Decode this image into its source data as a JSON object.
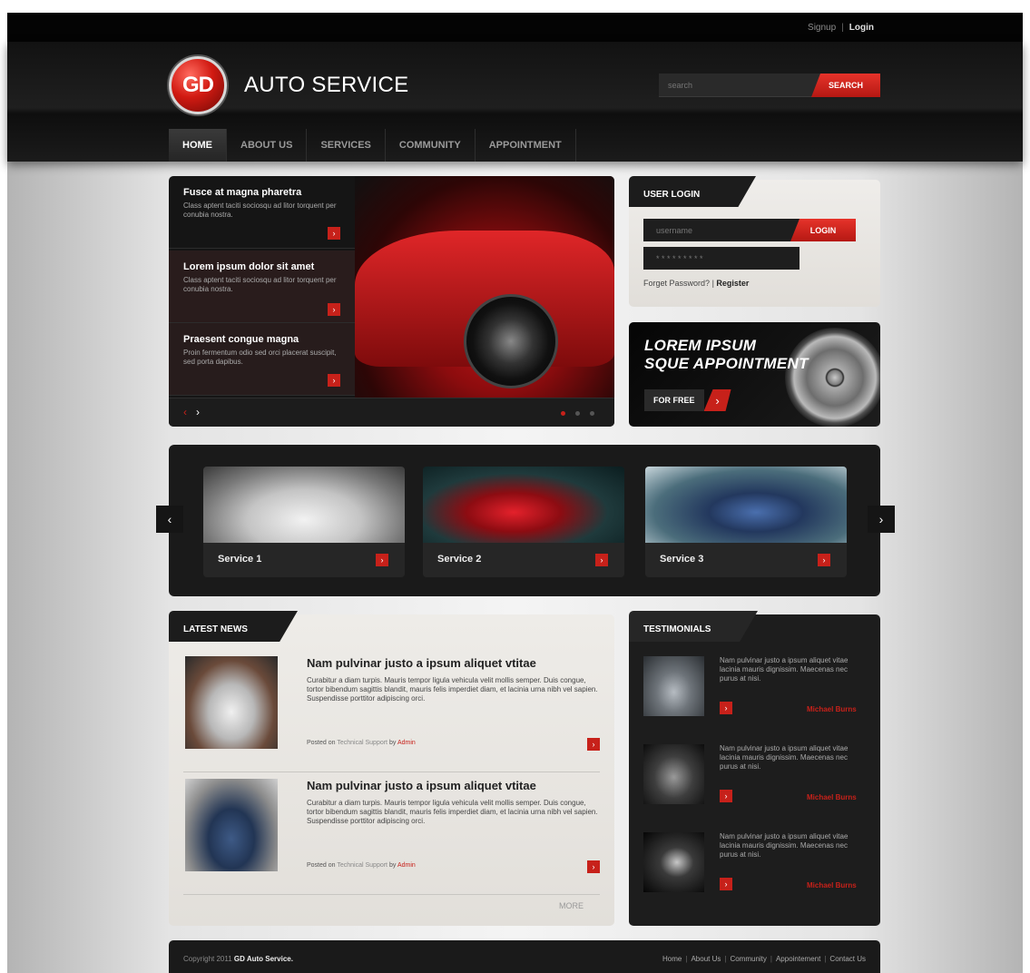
{
  "top_links": {
    "signup": "Signup",
    "separator": "|",
    "login": "Login"
  },
  "brand": {
    "logo_text": "GD",
    "name": "AUTO SERVICE"
  },
  "search": {
    "placeholder": "search",
    "button": "SEARCH"
  },
  "nav": [
    "HOME",
    "ABOUT US",
    "SERVICES",
    "COMMUNITY",
    "APPOINTMENT"
  ],
  "slides": [
    {
      "title": "Lorem ipsum dolor sit amet",
      "text": "Class aptent taciti sociosqu ad litor torquent per conubia nostra."
    },
    {
      "title": "Praesent congue magna",
      "text": "Proin fermentum odio sed orci placerat suscipit, sed porta dapibus."
    },
    {
      "title": "Fusce at magna pharetra",
      "text": "Class aptent taciti sociosqu ad litor torquent per conubia nostra."
    }
  ],
  "login": {
    "title": "USER LOGIN",
    "username_placeholder": "username",
    "password_placeholder": "* * * * * * * * *",
    "button": "LOGIN",
    "forgot": "Forget Password?",
    "sep": "|",
    "register": "Register"
  },
  "appointment": {
    "line1": "LOREM IPSUM",
    "line2": "SQUE APPOINTMENT",
    "button": "FOR FREE"
  },
  "services": [
    "Service 1",
    "Service 2",
    "Service 3"
  ],
  "news": {
    "title": "LATEST NEWS",
    "items": [
      {
        "title": "Nam pulvinar justo a ipsum aliquet vtitae",
        "text": "Curabitur a diam turpis. Mauris tempor ligula vehicula velit mollis semper. Duis congue, tortor bibendum sagittis blandit, mauris felis imperdiet diam, et lacinia urna nibh vel sapien. Suspendisse porttitor adipiscing orci.",
        "posted": "Posted on",
        "category": "Technical Support",
        "by": "by",
        "author": "Admin"
      },
      {
        "title": "Nam pulvinar justo a ipsum aliquet vtitae",
        "text": "Curabitur a diam turpis. Mauris tempor ligula vehicula velit mollis semper. Duis congue, tortor bibendum sagittis blandit, mauris felis imperdiet diam, et lacinia urna nibh vel sapien. Suspendisse porttitor adipiscing orci.",
        "posted": "Posted on",
        "category": "Technical Support",
        "by": "by",
        "author": "Admin"
      }
    ],
    "more": "MORE"
  },
  "testimonials": {
    "title": "TESTIMONIALS",
    "items": [
      {
        "text": "Nam pulvinar justo a ipsum aliquet vitae lacinia mauris dignissim. Maecenas nec purus at nisi.",
        "name": "Michael Burns"
      },
      {
        "text": "Nam pulvinar justo a ipsum aliquet vitae lacinia mauris dignissim. Maecenas nec purus at nisi.",
        "name": "Michael Burns"
      },
      {
        "text": "Nam pulvinar justo a ipsum aliquet vitae lacinia mauris dignissim. Maecenas nec purus at nisi.",
        "name": "Michael Burns"
      }
    ]
  },
  "footer": {
    "copyright": "Copyright 2011",
    "company": "GD Auto Service.",
    "links": [
      "Home",
      "About Us",
      "Community",
      "Appointement",
      "Contact Us"
    ]
  },
  "icons": {
    "arrow": "chevron-right-icon",
    "prev": "chevron-left-icon",
    "next": "chevron-right-icon"
  },
  "colors": {
    "accent": "#c7211a",
    "dark": "#1a1a1a"
  }
}
